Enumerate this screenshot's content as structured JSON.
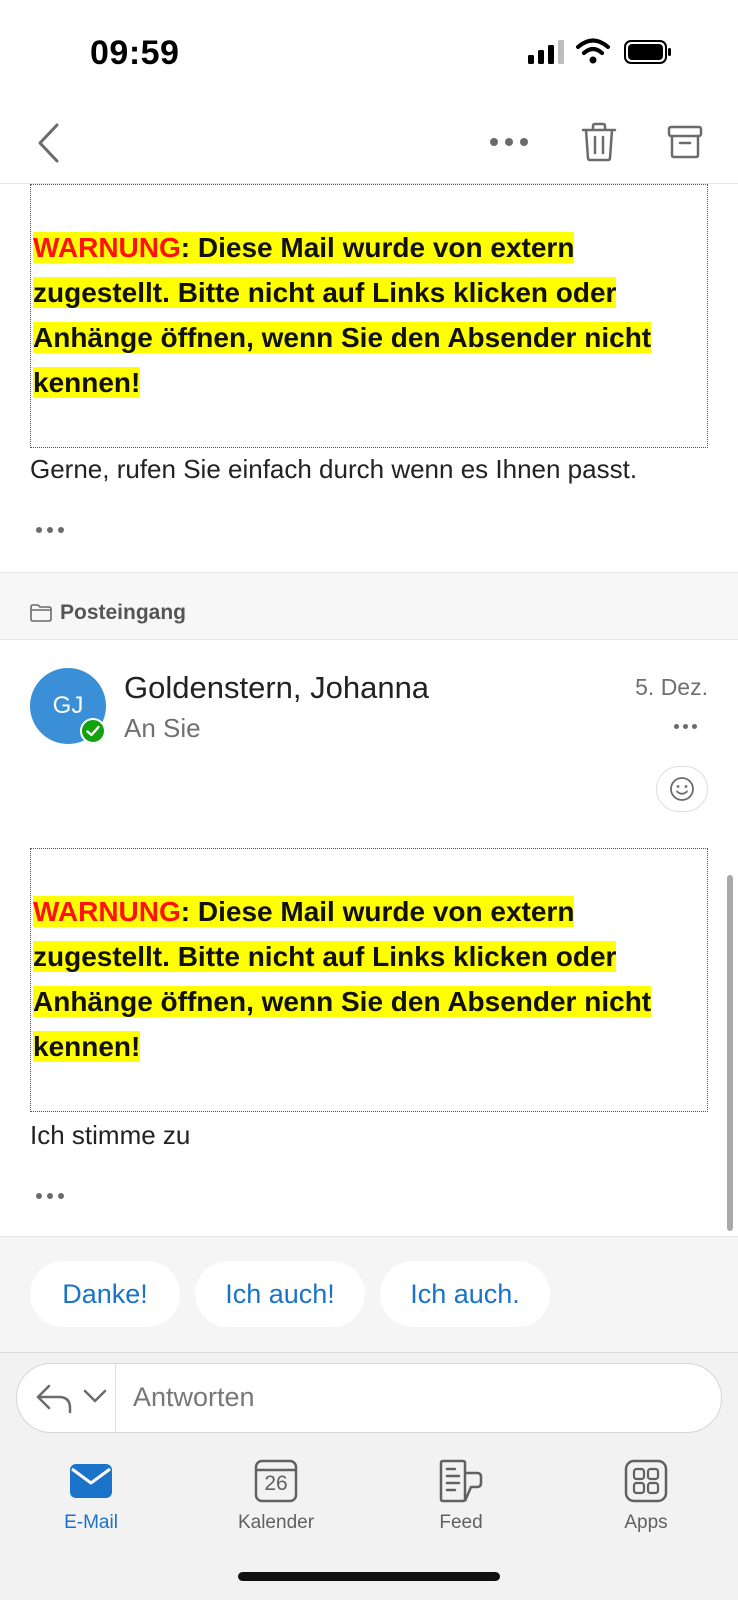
{
  "status_bar": {
    "time": "09:59"
  },
  "messages": [
    {
      "warning": {
        "word": "WARNUNG",
        "rest_line1": ": Diese Mail wurde von extern",
        "line2": "zugestellt. Bitte nicht auf Links klicken oder",
        "line3": "Anhänge öffnen, wenn Sie den Absender nicht",
        "line4": "kennen!"
      },
      "body": "Gerne, rufen Sie einfach durch wenn es Ihnen passt."
    },
    {
      "folder": "Posteingang",
      "sender": {
        "initials": "GJ",
        "name": "Goldenstern, Johanna",
        "to": "An Sie",
        "date": "5. Dez."
      },
      "warning": {
        "word": "WARNUNG",
        "rest_line1": ": Diese Mail wurde von extern",
        "line2": "zugestellt. Bitte nicht auf Links klicken oder",
        "line3": "Anhänge öffnen, wenn Sie den Absender nicht",
        "line4": "kennen!"
      },
      "body": "Ich stimme zu"
    }
  ],
  "quick_replies": [
    "Danke!",
    "Ich auch!",
    "Ich auch."
  ],
  "reply": {
    "placeholder": "Antworten"
  },
  "tabs": [
    {
      "label": "E-Mail",
      "icon": "mail-icon",
      "active": true
    },
    {
      "label": "Kalender",
      "icon": "calendar-icon",
      "day": "26"
    },
    {
      "label": "Feed",
      "icon": "feed-icon"
    },
    {
      "label": "Apps",
      "icon": "apps-icon"
    }
  ],
  "colors": {
    "accent": "#1a73c8",
    "warning_red": "#ff1111",
    "highlight": "#ffff00",
    "avatar": "#3a8fd6",
    "verified": "#13a10e"
  }
}
